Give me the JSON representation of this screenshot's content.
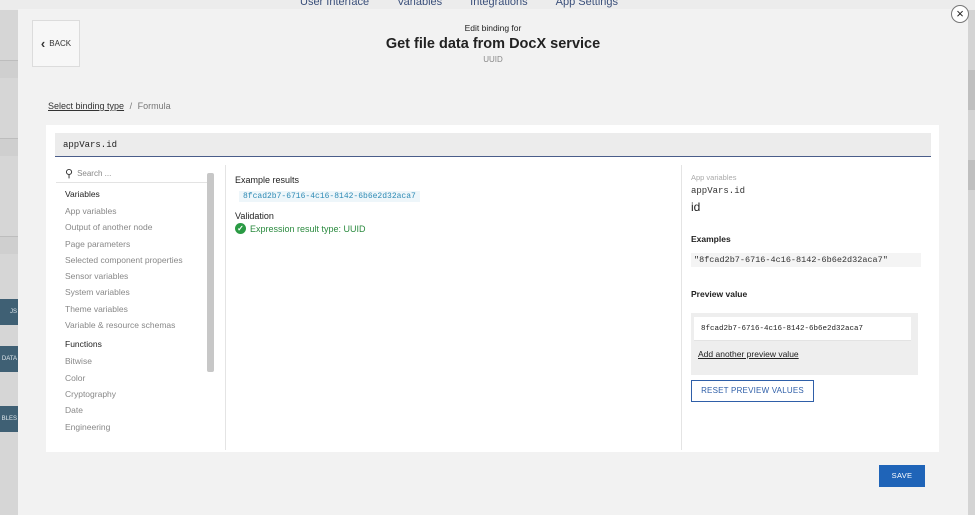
{
  "background": {
    "nav": [
      "User Interface",
      "Variables",
      "Integrations",
      "App Settings"
    ],
    "side_labels": [
      "JS",
      "DATA",
      "BLES"
    ]
  },
  "modal": {
    "close_glyph": "×",
    "back_label": "BACK",
    "subtitle": "Edit binding for",
    "title": "Get file data from DocX service",
    "type": "UUID"
  },
  "breadcrumb": {
    "link": "Select binding type",
    "separator": "/",
    "current": "Formula"
  },
  "expression": "appVars.id",
  "search": {
    "placeholder": "Search ..."
  },
  "variables": {
    "heading": "Variables",
    "items": [
      "App variables",
      "Output of another node",
      "Page parameters",
      "Selected component properties",
      "Sensor variables",
      "System variables",
      "Theme variables",
      "Variable & resource schemas"
    ]
  },
  "functions": {
    "heading": "Functions",
    "items": [
      "Bitwise",
      "Color",
      "Cryptography",
      "Date",
      "Engineering"
    ]
  },
  "results": {
    "heading": "Example results",
    "value": "8fcad2b7-6716-4c16-8142-6b6e2d32aca7",
    "validation_heading": "Validation",
    "validation_text": "Expression result type: UUID"
  },
  "details": {
    "category": "App variables",
    "expression": "appVars.id",
    "name": "id",
    "examples_heading": "Examples",
    "example_value": "\"8fcad2b7-6716-4c16-8142-6b6e2d32aca7\"",
    "preview_heading": "Preview value",
    "preview_value": "8fcad2b7-6716-4c16-8142-6b6e2d32aca7",
    "add_preview_label": "Add another preview value",
    "reset_label": "RESET PREVIEW VALUES"
  },
  "save_label": "SAVE",
  "colors": {
    "primary": "#1f64b8",
    "success": "#2a9a44",
    "link_chip": "#2f8bb5"
  }
}
